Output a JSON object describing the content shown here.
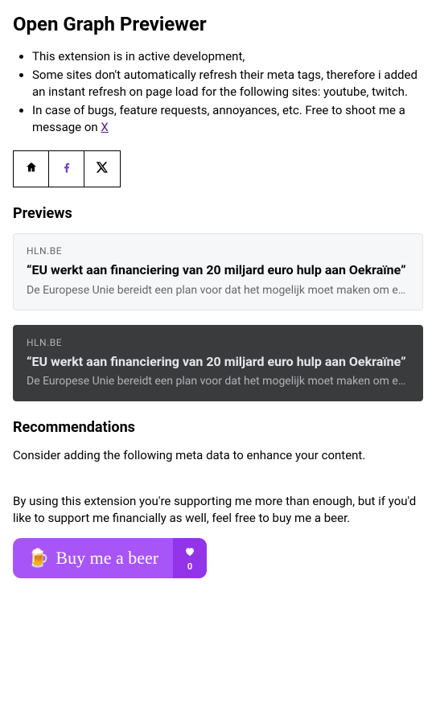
{
  "title": "Open Graph Previewer",
  "notes": [
    "This extension is in active development,",
    "Some sites don't automatically refresh their meta tags, therefore i added an instant refresh on page load for the following sites: youtube, twitch.",
    "In case of bugs, feature requests, annoyances, etc. Free to shoot me a message on "
  ],
  "link_label": "X",
  "previews_heading": "Previews",
  "preview": {
    "domain": "HLN.BE",
    "title": "“EU werkt aan financiering van 20 miljard euro hulp aan Oekraïne”",
    "description": "De Europese Unie bereidt een plan voor dat het mogelijk moet maken om een ..."
  },
  "recommendations_heading": "Recommendations",
  "recommendations_text": "Consider adding the following meta data to enhance your content.",
  "support_text": "By using this extension you're supporting me more than enough, but if you'd like to support me financially as well, feel free to buy me a beer.",
  "beer_button": "Buy me a beer",
  "beer_count": "0"
}
